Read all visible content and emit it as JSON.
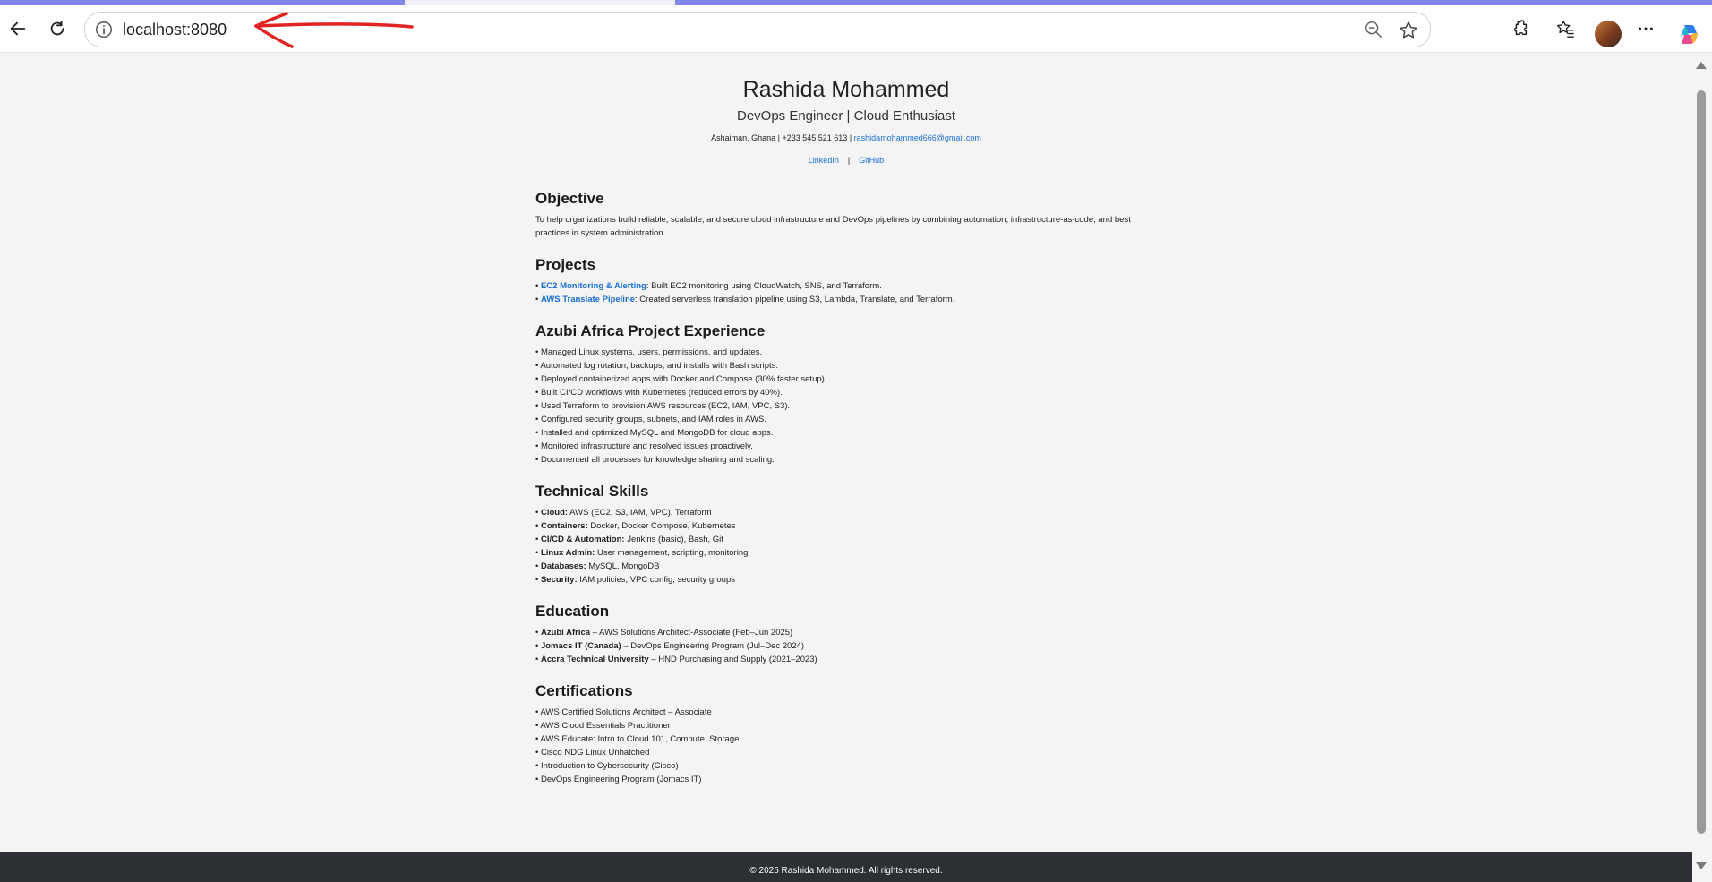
{
  "browser": {
    "url": "localhost:8080",
    "icons": [
      "back-icon",
      "refresh-icon",
      "info-icon",
      "zoom-out-icon",
      "star-icon",
      "extensions-icon",
      "favorites-icon",
      "avatar",
      "more-icon",
      "copilot-icon"
    ]
  },
  "resume": {
    "name": "Rashida Mohammed",
    "title": "DevOps Engineer | Cloud Enthusiast",
    "contact_text": "Ashaiman, Ghana | +233 545 521 613 |",
    "email": "rashidamohammed666@gmail.com",
    "links": {
      "linkedin": "LinkedIn",
      "sep": "|",
      "github": "GitHub"
    },
    "objective": {
      "heading": "Objective",
      "text": "To help organizations build reliable, scalable, and secure cloud infrastructure and DevOps pipelines by combining automation, infrastructure-as-code, and best practices in system administration."
    },
    "projects": {
      "heading": "Projects",
      "items": [
        {
          "bullet": "• ",
          "name": "EC2 Monitoring & Alerting",
          "desc": ": Built EC2 monitoring using CloudWatch, SNS, and Terraform."
        },
        {
          "bullet": "• ",
          "name": "AWS Translate Pipeline",
          "desc": ": Created serverless translation pipeline using S3, Lambda, Translate, and Terraform."
        }
      ]
    },
    "experience": {
      "heading": "Azubi Africa Project Experience",
      "items": [
        "• Managed Linux systems, users, permissions, and updates.",
        "• Automated log rotation, backups, and installs with Bash scripts.",
        "• Deployed containerized apps with Docker and Compose (30% faster setup).",
        "• Built CI/CD workflows with Kubernetes (reduced errors by 40%).",
        "• Used Terraform to provision AWS resources (EC2, IAM, VPC, S3).",
        "• Configured security groups, subnets, and IAM roles in AWS.",
        "• Installed and optimized MySQL and MongoDB for cloud apps.",
        "• Monitored infrastructure and resolved issues proactively.",
        "• Documented all processes for knowledge sharing and scaling."
      ]
    },
    "skills": {
      "heading": "Technical Skills",
      "items": [
        {
          "bullet": "• ",
          "label": "Cloud:",
          "value": " AWS (EC2, S3, IAM, VPC), Terraform"
        },
        {
          "bullet": "• ",
          "label": "Containers:",
          "value": " Docker, Docker Compose, Kubernetes"
        },
        {
          "bullet": "• ",
          "label": "CI/CD & Automation:",
          "value": " Jenkins (basic), Bash, Git"
        },
        {
          "bullet": "• ",
          "label": "Linux Admin:",
          "value": " User management, scripting, monitoring"
        },
        {
          "bullet": "• ",
          "label": "Databases:",
          "value": " MySQL, MongoDB"
        },
        {
          "bullet": "• ",
          "label": "Security:",
          "value": " IAM policies, VPC config, security groups"
        }
      ]
    },
    "education": {
      "heading": "Education",
      "items": [
        {
          "bullet": "• ",
          "school": "Azubi Africa",
          "detail": " – AWS Solutions Architect-Associate (Feb–Jun 2025)"
        },
        {
          "bullet": "• ",
          "school": "Jomacs IT (Canada)",
          "detail": " – DevOps Engineering Program (Jul–Dec 2024)"
        },
        {
          "bullet": "• ",
          "school": "Accra Technical University",
          "detail": " – HND Purchasing and Supply (2021–2023)"
        }
      ]
    },
    "certifications": {
      "heading": "Certifications",
      "items": [
        "• AWS Certified Solutions Architect – Associate",
        "• AWS Cloud Essentials Practitioner",
        "• AWS Educate: Intro to Cloud 101, Compute, Storage",
        "• Cisco NDG Linux Unhatched",
        "• Introduction to Cybersecurity (Cisco)",
        "• DevOps Engineering Program (Jomacs IT)"
      ]
    },
    "footer": "© 2025 Rashida Mohammed. All rights reserved."
  }
}
